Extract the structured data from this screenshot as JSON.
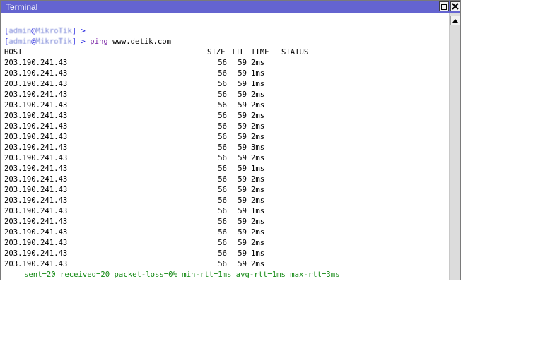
{
  "window": {
    "title": "Terminal"
  },
  "terminal": {
    "prompt1": {
      "open": "[",
      "user": "admin",
      "at": "@",
      "host": "MikroTik",
      "close": "] >"
    },
    "prompt2": {
      "open": "[",
      "user": "admin",
      "at": "@",
      "host": "MikroTik",
      "close": "] >",
      "command": "ping",
      "arg": "www.detik.com"
    },
    "headers": {
      "host": "HOST",
      "size": "SIZE",
      "ttl": "TTL",
      "time": "TIME",
      "status": "STATUS"
    },
    "rows": [
      {
        "host": "203.190.241.43",
        "size": "56",
        "ttl": "59",
        "time": "2ms"
      },
      {
        "host": "203.190.241.43",
        "size": "56",
        "ttl": "59",
        "time": "1ms"
      },
      {
        "host": "203.190.241.43",
        "size": "56",
        "ttl": "59",
        "time": "1ms"
      },
      {
        "host": "203.190.241.43",
        "size": "56",
        "ttl": "59",
        "time": "2ms"
      },
      {
        "host": "203.190.241.43",
        "size": "56",
        "ttl": "59",
        "time": "2ms"
      },
      {
        "host": "203.190.241.43",
        "size": "56",
        "ttl": "59",
        "time": "2ms"
      },
      {
        "host": "203.190.241.43",
        "size": "56",
        "ttl": "59",
        "time": "2ms"
      },
      {
        "host": "203.190.241.43",
        "size": "56",
        "ttl": "59",
        "time": "2ms"
      },
      {
        "host": "203.190.241.43",
        "size": "56",
        "ttl": "59",
        "time": "3ms"
      },
      {
        "host": "203.190.241.43",
        "size": "56",
        "ttl": "59",
        "time": "2ms"
      },
      {
        "host": "203.190.241.43",
        "size": "56",
        "ttl": "59",
        "time": "1ms"
      },
      {
        "host": "203.190.241.43",
        "size": "56",
        "ttl": "59",
        "time": "2ms"
      },
      {
        "host": "203.190.241.43",
        "size": "56",
        "ttl": "59",
        "time": "2ms"
      },
      {
        "host": "203.190.241.43",
        "size": "56",
        "ttl": "59",
        "time": "2ms"
      },
      {
        "host": "203.190.241.43",
        "size": "56",
        "ttl": "59",
        "time": "1ms"
      },
      {
        "host": "203.190.241.43",
        "size": "56",
        "ttl": "59",
        "time": "2ms"
      },
      {
        "host": "203.190.241.43",
        "size": "56",
        "ttl": "59",
        "time": "2ms"
      },
      {
        "host": "203.190.241.43",
        "size": "56",
        "ttl": "59",
        "time": "2ms"
      },
      {
        "host": "203.190.241.43",
        "size": "56",
        "ttl": "59",
        "time": "1ms"
      },
      {
        "host": "203.190.241.43",
        "size": "56",
        "ttl": "59",
        "time": "2ms"
      }
    ],
    "summary": "sent=20 received=20 packet-loss=0% min-rtt=1ms avg-rtt=1ms max-rtt=3ms"
  },
  "colors": {
    "titlebar": "#6464d0",
    "prompt": "#2a2ae0",
    "command": "#7d2aa8",
    "summary": "#118811"
  },
  "icons": {
    "maximize": "maximize-icon",
    "close": "close-icon",
    "scroll_up": "arrow-up-icon"
  }
}
